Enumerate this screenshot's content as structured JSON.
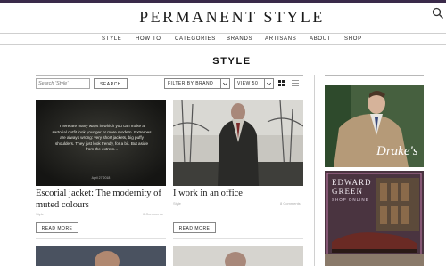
{
  "header": {
    "site_title": "PERMANENT STYLE",
    "search_icon": "search-icon"
  },
  "nav": {
    "items": [
      "STYLE",
      "HOW TO",
      "CATEGORIES",
      "BRANDS",
      "ARTISANS",
      "ABOUT",
      "SHOP"
    ]
  },
  "page": {
    "heading": "STYLE"
  },
  "filters": {
    "search_placeholder": "Search 'Style'",
    "search_button": "SEARCH",
    "filter_brand": "FILTER BY BRAND",
    "view": "VIEW 50",
    "grid_icon": "grid-view-icon",
    "list_icon": "list-view-icon"
  },
  "articles": [
    {
      "title": "Escorial jacket: The modernity of muted colours",
      "category": "Style",
      "comments": "0 Comments",
      "read_more": "READ MORE",
      "overlay_text": "There are many ways in which you can make a sartorial outfit look younger or more modern. Extremes are always wrong: very short jackets, big puffy shoulders. They just look trendy, for a bit. But aside from the extrem...",
      "overlay_date": "April 27 2018"
    },
    {
      "title": "I work in an office",
      "category": "Style",
      "comments": "8 Comments",
      "read_more": "READ MORE"
    }
  ],
  "sidebar": {
    "ad1_brand": "Drake's",
    "ad2_brand_line1": "EDWARD",
    "ad2_brand_line2": "GREEN",
    "ad2_tagline": "SHOP ONLINE"
  },
  "colors": {
    "topbar": "#3a2a4a",
    "text": "#222222",
    "border": "#888888"
  }
}
